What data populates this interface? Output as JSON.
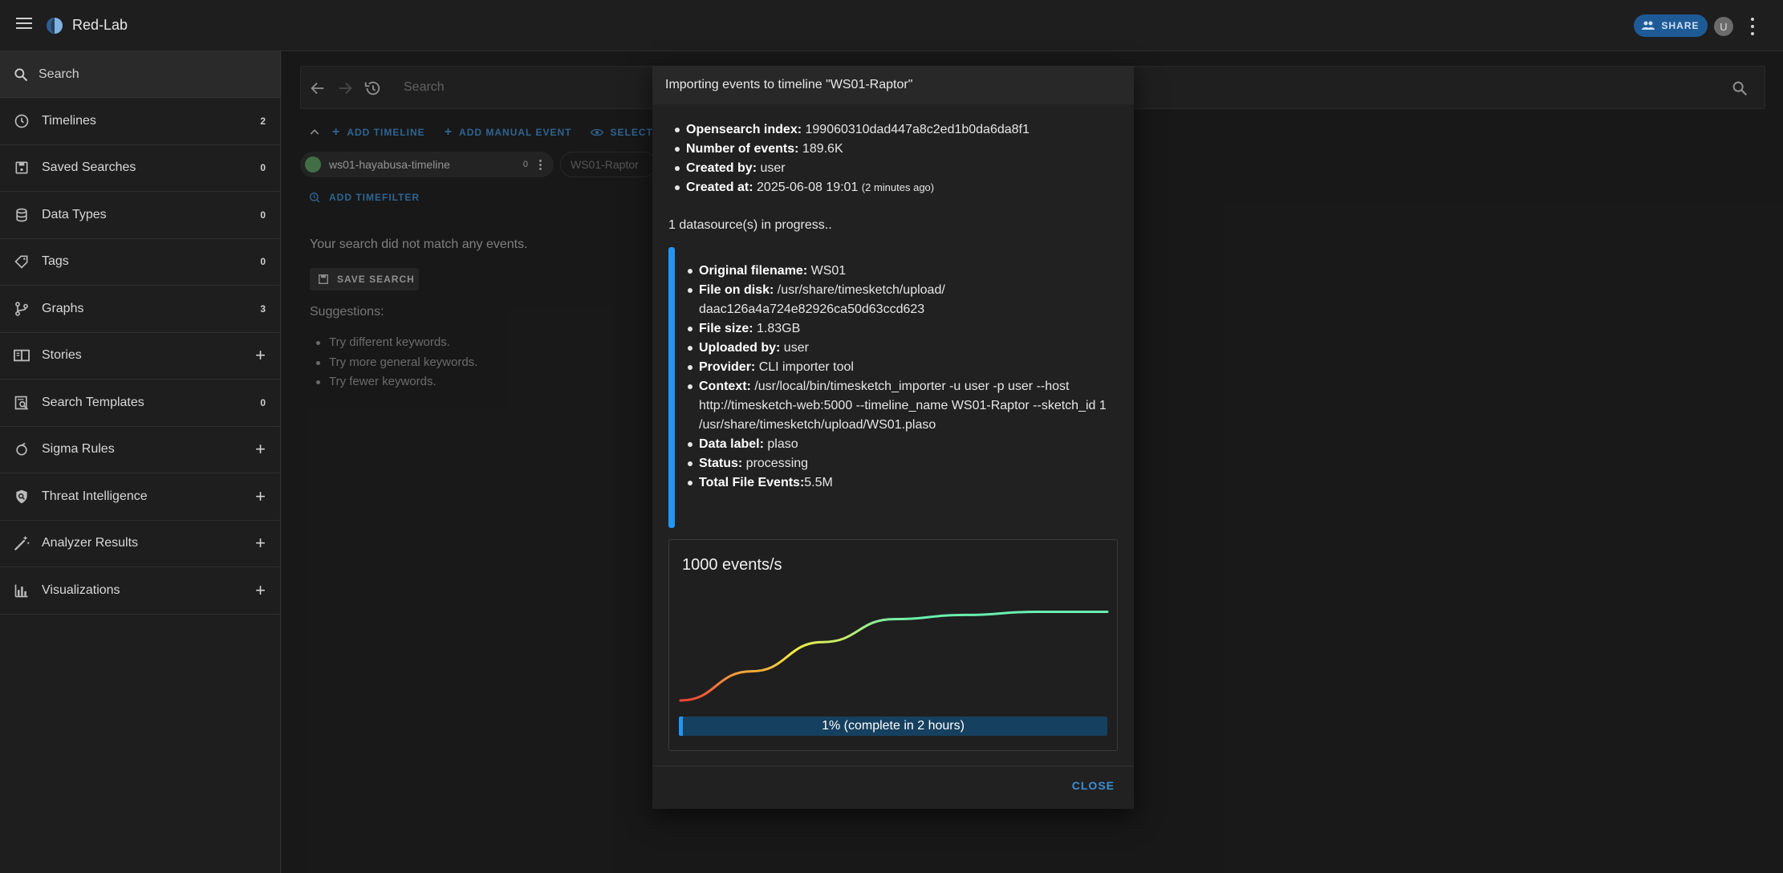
{
  "app": {
    "title": "Red-Lab",
    "share_label": "SHARE",
    "avatar_initial": "U"
  },
  "sidebar": {
    "search_placeholder": "Search",
    "items": [
      {
        "label": "Timelines",
        "count": "2",
        "icon": "clock-icon"
      },
      {
        "label": "Saved Searches",
        "count": "0",
        "icon": "save-icon"
      },
      {
        "label": "Data Types",
        "count": "0",
        "icon": "database-icon"
      },
      {
        "label": "Tags",
        "count": "0",
        "icon": "tag-icon"
      },
      {
        "label": "Graphs",
        "count": "3",
        "icon": "graph-icon"
      },
      {
        "label": "Stories",
        "count": "+",
        "icon": "book-icon"
      },
      {
        "label": "Search Templates",
        "count": "0",
        "icon": "search-template-icon"
      },
      {
        "label": "Sigma Rules",
        "count": "+",
        "icon": "sigma-icon"
      },
      {
        "label": "Threat Intelligence",
        "count": "+",
        "icon": "shield-icon"
      },
      {
        "label": "Analyzer Results",
        "count": "+",
        "icon": "wand-icon"
      },
      {
        "label": "Visualizations",
        "count": "+",
        "icon": "bar-chart-icon"
      }
    ]
  },
  "main": {
    "search_placeholder": "Search",
    "actions": {
      "add_timeline": "ADD TIMELINE",
      "add_manual_event": "ADD MANUAL EVENT",
      "select": "SELECT"
    },
    "timeline_chip": {
      "name": "ws01-hayabusa-timeline",
      "count": "0"
    },
    "timeline_chip2": "WS01-Raptor",
    "add_timefilter": "ADD TIMEFILTER",
    "no_match": "Your search did not match any events.",
    "save_search": "SAVE SEARCH",
    "suggestions_title": "Suggestions:",
    "suggestions": [
      "Try different keywords.",
      "Try more general keywords.",
      "Try fewer keywords."
    ]
  },
  "dialog": {
    "title": "Importing events to timeline \"WS01-Raptor\"",
    "info": [
      {
        "key": "Opensearch index:",
        "value": " 199060310dad447a8c2ed1b0da6da8f1"
      },
      {
        "key": "Number of events:",
        "value": " 189.6K"
      },
      {
        "key": "Created by:",
        "value": " user"
      },
      {
        "key": "Created at:",
        "value": " 2025-06-08 19:01 ",
        "small": "(2 minutes ago)"
      }
    ],
    "progress_text": "1 datasource(s) in progress..",
    "datasource": [
      {
        "key": "Original filename:",
        "value": " WS01"
      },
      {
        "key": "File on disk:",
        "value": " /usr/share/timesketch/upload/ daac126a4a724e82926ca50d63ccd623"
      },
      {
        "key": "File size:",
        "value": " 1.83GB"
      },
      {
        "key": "Uploaded by:",
        "value": " user"
      },
      {
        "key": "Provider:",
        "value": " CLI importer tool"
      },
      {
        "key": "Context:",
        "value": " /usr/local/bin/timesketch_importer -u user -p user --host http://timesketch-web:5000 --timeline_name WS01-Raptor --sketch_id 1 /usr/share/timesketch/upload/WS01.plaso"
      },
      {
        "key": "Data label:",
        "value": " plaso"
      },
      {
        "key": "Status:",
        "value": " processing"
      },
      {
        "key": "Total File Events:",
        "value": "5.5M"
      }
    ],
    "rate_label": "1000 events/s",
    "progress_percent": 1,
    "progress_label": "1% (complete in 2 hours)",
    "close_label": "CLOSE"
  },
  "chart_data": {
    "type": "line",
    "title": "1000 events/s",
    "x": [
      0,
      1,
      2,
      3,
      4,
      5,
      6
    ],
    "series": [
      {
        "values": [
          0,
          0.28,
          0.56,
          0.78,
          0.82,
          0.85,
          0.85
        ]
      }
    ],
    "colors": {
      "low": "#f44336",
      "mid": "#ffeb3b",
      "high": "#69f0ae"
    }
  },
  "colors": {
    "accent": "#2196f3",
    "link": "#3b8fd6",
    "background": "#1e1e1e"
  }
}
